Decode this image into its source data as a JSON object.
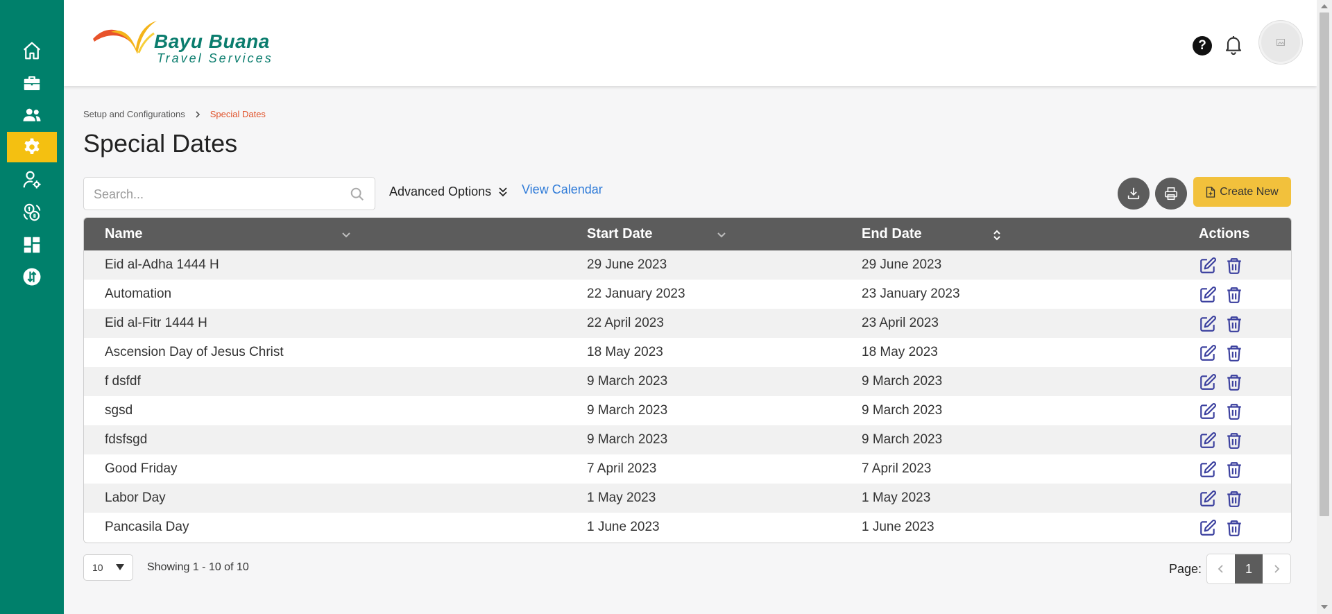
{
  "brand": {
    "title": "Bayu Buana",
    "subtitle": "Travel Services"
  },
  "sidebar": {
    "items": [
      {
        "icon": "home-icon"
      },
      {
        "icon": "briefcase-icon"
      },
      {
        "icon": "users-icon"
      },
      {
        "icon": "gear-icon",
        "active": true
      },
      {
        "icon": "user-settings-icon"
      },
      {
        "icon": "currency-exchange-icon"
      },
      {
        "icon": "dashboard-icon"
      },
      {
        "icon": "transfer-icon"
      }
    ]
  },
  "header": {
    "help_label": "?"
  },
  "breadcrumb": {
    "parent": "Setup and Configurations",
    "current": "Special Dates"
  },
  "page": {
    "title": "Special Dates"
  },
  "toolbar": {
    "search_placeholder": "Search...",
    "advanced_label": "Advanced Options",
    "view_calendar_label": "View Calendar",
    "create_label": "Create New"
  },
  "table": {
    "columns": [
      "Name",
      "Start Date",
      "End Date",
      "Actions"
    ],
    "rows": [
      {
        "name": "Eid al-Adha 1444 H",
        "start": "29 June 2023",
        "end": "29 June 2023"
      },
      {
        "name": "Automation",
        "start": "22 January 2023",
        "end": "23 January 2023"
      },
      {
        "name": "Eid al-Fitr 1444 H",
        "start": "22 April 2023",
        "end": "23 April 2023"
      },
      {
        "name": "Ascension Day of Jesus Christ",
        "start": "18 May 2023",
        "end": "18 May 2023"
      },
      {
        "name": "f dsfdf",
        "start": "9 March 2023",
        "end": "9 March 2023"
      },
      {
        "name": "sgsd",
        "start": "9 March 2023",
        "end": "9 March 2023"
      },
      {
        "name": "fdsfsgd",
        "start": "9 March 2023",
        "end": "9 March 2023"
      },
      {
        "name": "Good Friday",
        "start": "7 April 2023",
        "end": "7 April 2023"
      },
      {
        "name": "Labor Day",
        "start": "1 May 2023",
        "end": "1 May 2023"
      },
      {
        "name": "Pancasila Day",
        "start": "1 June 2023",
        "end": "1 June 2023"
      }
    ]
  },
  "footer": {
    "page_size": "10",
    "showing": "Showing 1 - 10 of 10",
    "page_label": "Page:",
    "current_page": "1"
  },
  "colors": {
    "sidebar": "#00806b",
    "active": "#f4c011",
    "table_header": "#5c5c5c",
    "breadcrumb_current": "#e0522a",
    "link": "#2f7bd8",
    "create_button": "#f2c13c",
    "action_icons": "#3a3f9e"
  }
}
